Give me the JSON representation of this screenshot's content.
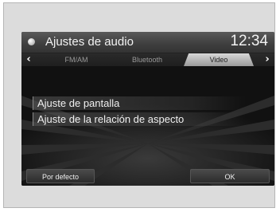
{
  "header": {
    "title": "Ajustes de audio",
    "clock": "12:34"
  },
  "tabs": [
    {
      "label": "FM/AM",
      "active": false
    },
    {
      "label": "Bluetooth",
      "active": false
    },
    {
      "label": "Video",
      "active": true
    }
  ],
  "nav": {
    "left_arrow": "‹",
    "right_arrow": "›"
  },
  "menu": {
    "items": [
      {
        "label": "Ajuste de pantalla"
      },
      {
        "label": "Ajuste de la relación de aspecto"
      }
    ]
  },
  "buttons": {
    "default_label": "Por defecto",
    "ok_label": "OK"
  }
}
